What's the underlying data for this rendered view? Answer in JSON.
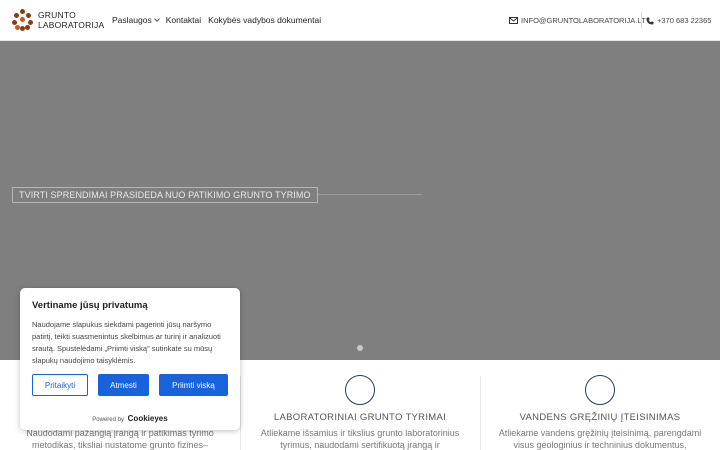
{
  "header": {
    "logo_line1": "GRUNTO",
    "logo_line2": "LABORATORIJA",
    "nav": [
      {
        "label": "Paslaugos",
        "has_dropdown": true
      },
      {
        "label": "Kontaktai"
      },
      {
        "label": "Kokybės vadybos dokumentai"
      }
    ],
    "email": "INFO@GRUNTOLABORATORIJA.LT",
    "phone": "+370 683 22365"
  },
  "hero": {
    "tagline": "TVIRTI SPRENDIMAI PRASIDEDA NUO PATIKIMO GRUNTO TYRIMO",
    "background_color": "#7f7f7f"
  },
  "features": [
    {
      "title": "",
      "text": "Naudodami pažangią įrangą ir patikimas tyrimo metodikas, tiksliai nustatome grunto fizines–"
    },
    {
      "title": "LABORATORINIAI GRUNTO TYRIMAI",
      "text": "Atliekame išsamius ir tikslius grunto laboratorinius tyrimus, naudodami sertifikuotą įrangą ir"
    },
    {
      "title": "VANDENS GRĘŽINIŲ ĮTEISINIMAS",
      "text": "Atliekame vandens gręžinių įteisinimą, parengdami visus geologinius ir techninius dokumentus,"
    }
  ],
  "cookie": {
    "title": "Vertiname jūsų privatumą",
    "text": "Naudojame slapukus siekdami pagerinti jūsų naršymo patirtį, teikti suasmenintus skelbimus ar turinį ir analizuoti srautą. Spustelėdami „Priimti viską\" sutinkate su mūsų slapukų naudojimo taisyklėmis.",
    "customize_label": "Pritaikyti",
    "reject_label": "Atmesti",
    "accept_label": "Priimti viską",
    "powered_by": "Powered by",
    "brand": "Cookieyes",
    "accent_color": "#1863dc"
  }
}
